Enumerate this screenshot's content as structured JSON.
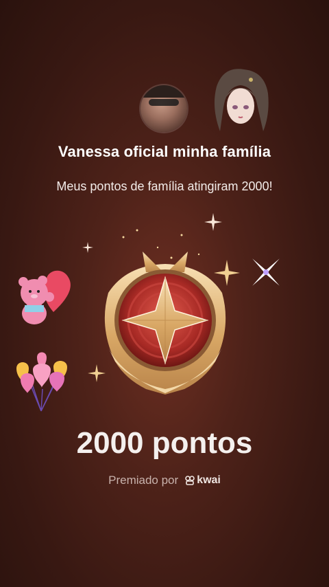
{
  "card": {
    "title": "Vanessa oficial minha família",
    "subtitle": "Meus pontos de família atingiram 2000!",
    "points_text": "2000 pontos",
    "awarded_by_label": "Premiado por",
    "brand_name": "kwai"
  },
  "icons": {
    "teddy": "teddy-bear-heart-sticker",
    "balloons": "heart-balloons-sticker",
    "badge": "star-medal-badge",
    "brand": "kwai-logo"
  },
  "colors": {
    "background": "#4e2219",
    "gold": "#e9c48a",
    "badge_red": "#b3322b"
  }
}
